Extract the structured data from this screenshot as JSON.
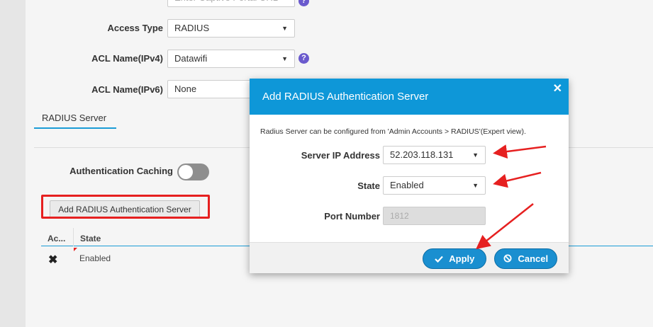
{
  "form": {
    "captive_portal_placeholder": "Enter Captive Portal URL",
    "access_type": {
      "label": "Access Type",
      "value": "RADIUS"
    },
    "acl_ipv4": {
      "label": "ACL Name(IPv4)",
      "value": "Datawifi"
    },
    "acl_ipv6": {
      "label": "ACL Name(IPv6)",
      "value": "None"
    },
    "help_glyph": "?"
  },
  "tabs": {
    "radius_server": "RADIUS Server"
  },
  "auth_caching": {
    "label": "Authentication Caching",
    "enabled": false
  },
  "add_button_label": "Add RADIUS Authentication Server",
  "table": {
    "headers": [
      "Ac...",
      "State"
    ],
    "rows": [
      {
        "action_icon": "close-icon",
        "action_glyph": "✖",
        "state": "Enabled"
      }
    ]
  },
  "modal": {
    "title": "Add RADIUS Authentication Server",
    "close_glyph": "✕",
    "note": "Radius Server can be configured from 'Admin Accounts > RADIUS'(Expert view).",
    "server_ip": {
      "label": "Server IP Address",
      "value": "52.203.118.131"
    },
    "state": {
      "label": "State",
      "value": "Enabled"
    },
    "port": {
      "label": "Port Number",
      "value": "1812"
    },
    "apply_label": "Apply",
    "cancel_label": "Cancel",
    "caret_glyph": "▼"
  },
  "colors": {
    "accent": "#0e97d8",
    "button": "#1a8fd0",
    "annotation_red": "#e62020",
    "help_purple": "#6a5acd"
  }
}
